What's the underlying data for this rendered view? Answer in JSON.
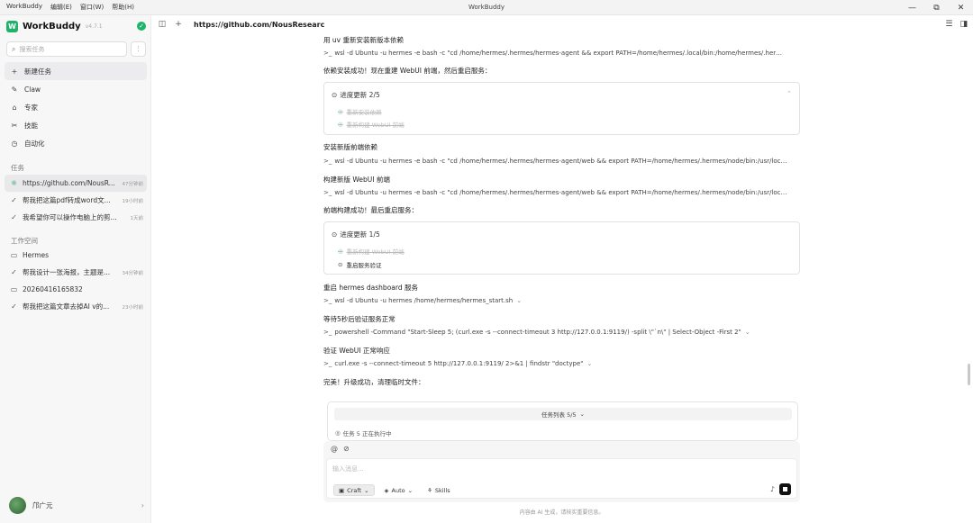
{
  "window": {
    "title": "WorkBuddy",
    "menu": [
      "WorkBuddy",
      "编辑(E)",
      "窗口(W)",
      "帮助(H)"
    ],
    "controls": [
      "—",
      "⧉",
      "✕"
    ]
  },
  "sidebar": {
    "brand": {
      "name": "WorkBuddy",
      "version": "v4.7.1",
      "badge": "✓"
    },
    "search": {
      "placeholder": "搜索任务"
    },
    "nav": [
      {
        "label": "新建任务",
        "icon": "plus-icon"
      },
      {
        "label": "Claw",
        "icon": "claw-icon"
      },
      {
        "label": "专家",
        "icon": "expert-icon"
      },
      {
        "label": "技能",
        "icon": "skill-icon"
      },
      {
        "label": "自动化",
        "icon": "clock-icon"
      }
    ],
    "tasks_label": "任务",
    "tasks": [
      {
        "name": "https://github.com/NousR...",
        "time": "47分钟前",
        "status": "running"
      },
      {
        "name": "帮我把这篇pdf转成word文...",
        "time": "19小时前",
        "status": "done"
      },
      {
        "name": "我希望你可以操作电脑上的剪...",
        "time": "1天前",
        "status": "done"
      }
    ],
    "workspace_label": "工作空间",
    "workspaces": [
      {
        "folder": "Hermes",
        "tasks": [
          {
            "name": "帮我设计一张海报，主题是...",
            "time": "34分钟前"
          }
        ]
      },
      {
        "folder": "20260416165832",
        "tasks": [
          {
            "name": "帮我把这篇文章去掉AI v的...",
            "time": "23小时前"
          }
        ]
      }
    ],
    "user": {
      "name": "邝广元"
    }
  },
  "topbar": {
    "url": "https://github.com/NousResearc"
  },
  "conversation": {
    "h1": "用 uv 重新安装新版本依赖",
    "cmd1": "wsl -d Ubuntu -u hermes -e bash -c \"cd /home/hermes/.hermes/hermes-agent && export PATH=/home/hermes/.local/bin:/home/hermes/.hermes...",
    "h2": "依赖安装成功！现在重建 WebUI 前端，然后重启服务：",
    "progress1": {
      "title": "进度更新 2/5",
      "items": [
        {
          "label": "重新安装依赖",
          "done": true
        },
        {
          "label": "重新构建 WebUI 前端",
          "done": true
        }
      ]
    },
    "h3": "安装新版前端依赖",
    "cmd2": "wsl -d Ubuntu -u hermes -e bash -c \"cd /home/hermes/.hermes/hermes-agent/web && export PATH=/home/hermes/.hermes/node/bin:/usr/local...",
    "h4": "构建新版 WebUI 前端",
    "cmd3": "wsl -d Ubuntu -u hermes -e bash -c \"cd /home/hermes/.hermes/hermes-agent/web && export PATH=/home/hermes/.hermes/node/bin:/usr/local...",
    "h5": "前端构建成功！最后重启服务：",
    "progress2": {
      "title": "进度更新 1/5",
      "items": [
        {
          "label": "重新构建 WebUI 前端",
          "done": true
        },
        {
          "label": "重启服务验证",
          "done": false
        }
      ]
    },
    "h6": "重启 hermes dashboard 服务",
    "cmd4": "wsl -d Ubuntu -u hermes /home/hermes/hermes_start.sh",
    "h7": "等待5秒后验证服务正常",
    "cmd5": "powershell -Command \"Start-Sleep 5; (curl.exe -s --connect-timeout 3 http://127.0.0.1:9119/) -split \\\"`n\\\" | Select-Object -First 2\"",
    "h8": "验证 WebUI 正常响应",
    "cmd6": "curl.exe -s --connect-timeout 5 http://127.0.0.1:9119/ 2>&1 | findstr \"doctype\"",
    "h9": "完美！升级成功，清理临时文件："
  },
  "queue": {
    "bar": "任务列表 5/5",
    "item": "任务 5 正在执行中"
  },
  "composer": {
    "placeholder": "输入消息...",
    "mode": "Craft",
    "model": "Auto",
    "skills": "Skills"
  },
  "footnote": "内容由 AI 生成，请核实重要信息。"
}
